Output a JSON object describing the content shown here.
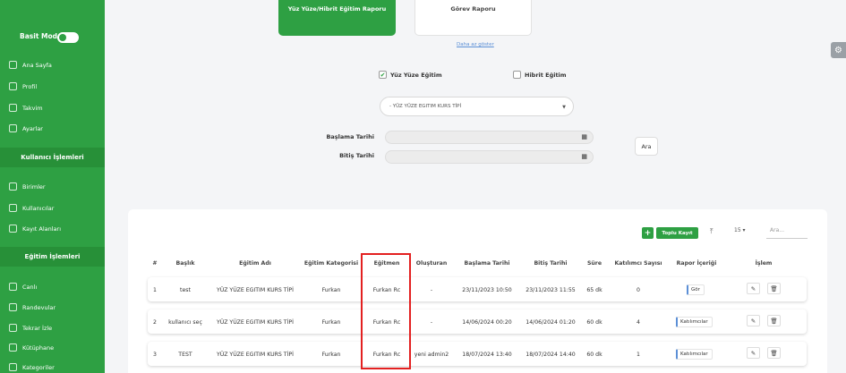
{
  "sidebar": {
    "basit_mod": "Basit Mod",
    "items_top": [
      "Ana Sayfa",
      "Profil",
      "Takvim",
      "Ayarlar"
    ],
    "section1": "Kullanıcı İşlemleri",
    "items_mid": [
      "Birimler",
      "Kullanıcılar",
      "Kayıt Alanları"
    ],
    "section2": "Eğitim İşlemleri",
    "items_bot": [
      "Canlı",
      "Randevular",
      "Tekrar İzle",
      "Kütüphane",
      "Kategoriler"
    ]
  },
  "tabs": {
    "tab1": "Yüz Yüze/Hibrit Eğitim Raporu",
    "tab2": "Görev Raporu",
    "link": "Daha az göster"
  },
  "filters": {
    "check1": "Yüz Yüze Eğitim",
    "check1_mark": "✔",
    "check2": "Hibrit Eğitim",
    "select": "- YÜZ YÜZE EGITIM KURS TİPİ",
    "start_label": "Başlama Tarihi",
    "end_label": "Bitiş Tarihi",
    "search_btn": "Ara"
  },
  "toolbar": {
    "plus": "+",
    "toplu": "Toplu Kayıt",
    "upload_icon": "⤒",
    "per_page": "15 ▾",
    "search_placeholder": "Ara..."
  },
  "table": {
    "headers": [
      "#",
      "Başlık",
      "Eğitim Adı",
      "Eğitim Kategorisi",
      "Eğitmen",
      "Oluşturan",
      "Başlama Tarihi",
      "Bitiş Tarihi",
      "Süre",
      "Katılımcı Sayısı",
      "Rapor İçeriği",
      "İşlem"
    ],
    "rows": [
      [
        "1",
        "test",
        "YÜZ YÜZE EGITIM KURS TİPİ",
        "Furkan",
        "Furkan Rc",
        "-",
        "23/11/2023 10:50",
        "23/11/2023 11:55",
        "65 dk",
        "0",
        "Gör"
      ],
      [
        "2",
        "kullanıcı seç",
        "YÜZ YÜZE EGITIM KURS TİPİ",
        "Furkan",
        "Furkan Rc",
        "-",
        "14/06/2024 00:20",
        "14/06/2024 01:20",
        "60 dk",
        "4",
        "Katılımcılar"
      ],
      [
        "3",
        "TEST",
        "YÜZ YÜZE EGITIM KURS TİPİ",
        "Furkan",
        "Furkan Rc",
        "yeni admin2",
        "18/07/2024 13:40",
        "18/07/2024 14:40",
        "60 dk",
        "1",
        "Katılımcılar"
      ]
    ]
  },
  "colors": {
    "accent": "#2ea043",
    "highlight": "#e32020"
  }
}
